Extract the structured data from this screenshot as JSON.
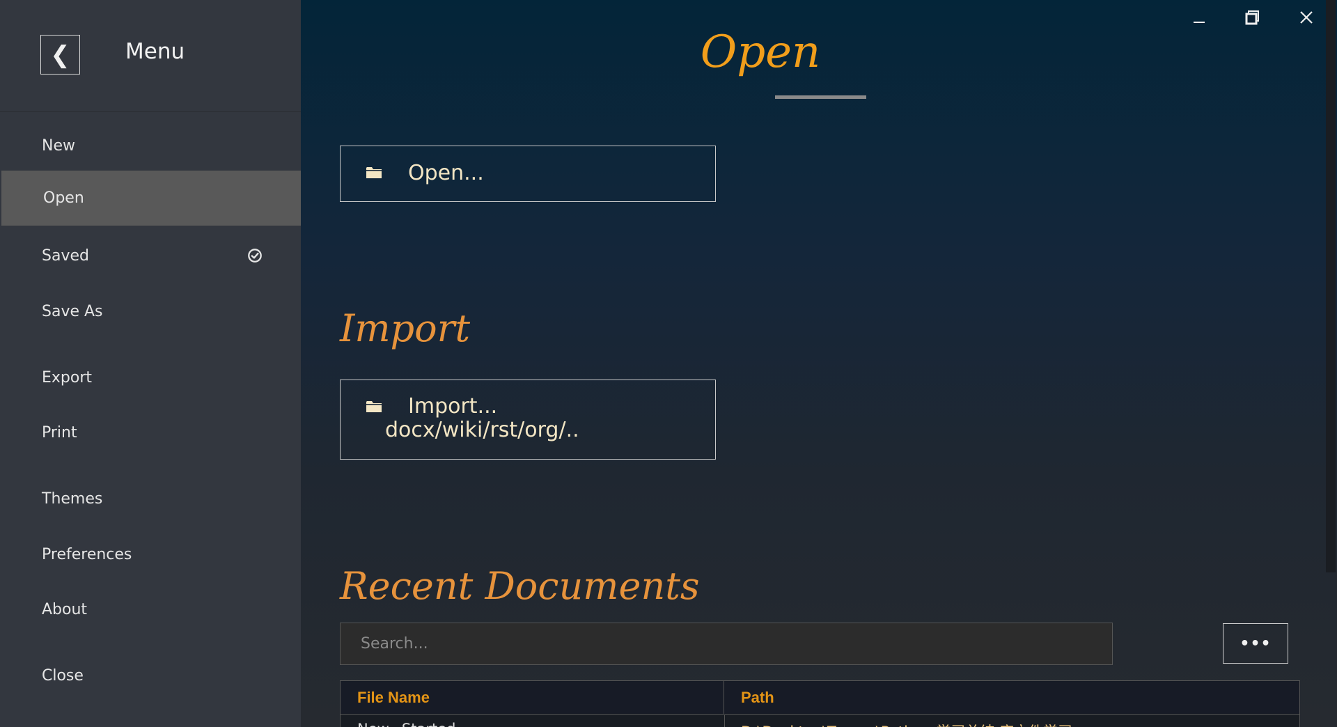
{
  "sidebar": {
    "title": "Menu",
    "back_icon": "chevron-left-icon",
    "items": [
      {
        "label": "New"
      },
      {
        "label": "Open"
      },
      {
        "label": "Saved"
      },
      {
        "label": "Save As"
      },
      {
        "label": "Export"
      },
      {
        "label": "Print"
      },
      {
        "label": "Themes"
      },
      {
        "label": "Preferences"
      },
      {
        "label": "About"
      },
      {
        "label": "Close"
      }
    ],
    "active_item": "Open",
    "saved_status_icon": "check-circle-icon"
  },
  "window_controls": {
    "minimize_icon": "minimize-icon",
    "restore_icon": "restore-icon",
    "close_icon": "close-icon"
  },
  "open_section": {
    "title": "Open",
    "button_label": "Open...",
    "button_icon": "folder-icon"
  },
  "import_section": {
    "title": "Import",
    "button_label_line1": "Import...",
    "button_label_line2": "docx/wiki/rst/org/..",
    "button_icon": "folder-icon"
  },
  "recent_section": {
    "title": "Recent Documents",
    "search_placeholder": "Search...",
    "more_label": "•••",
    "columns": [
      "File Name",
      "Path"
    ],
    "rows": [
      {
        "name": "New...Started...",
        "path": "D:\\Desktop\\Typora\\Python 学习总结 库文件学习"
      }
    ]
  },
  "colors": {
    "accent": "#f19e1b",
    "section_title": "#e7933c",
    "sidebar_bg": "#33373f",
    "sidebar_active": "#595959",
    "table_header_text": "#e39416"
  }
}
